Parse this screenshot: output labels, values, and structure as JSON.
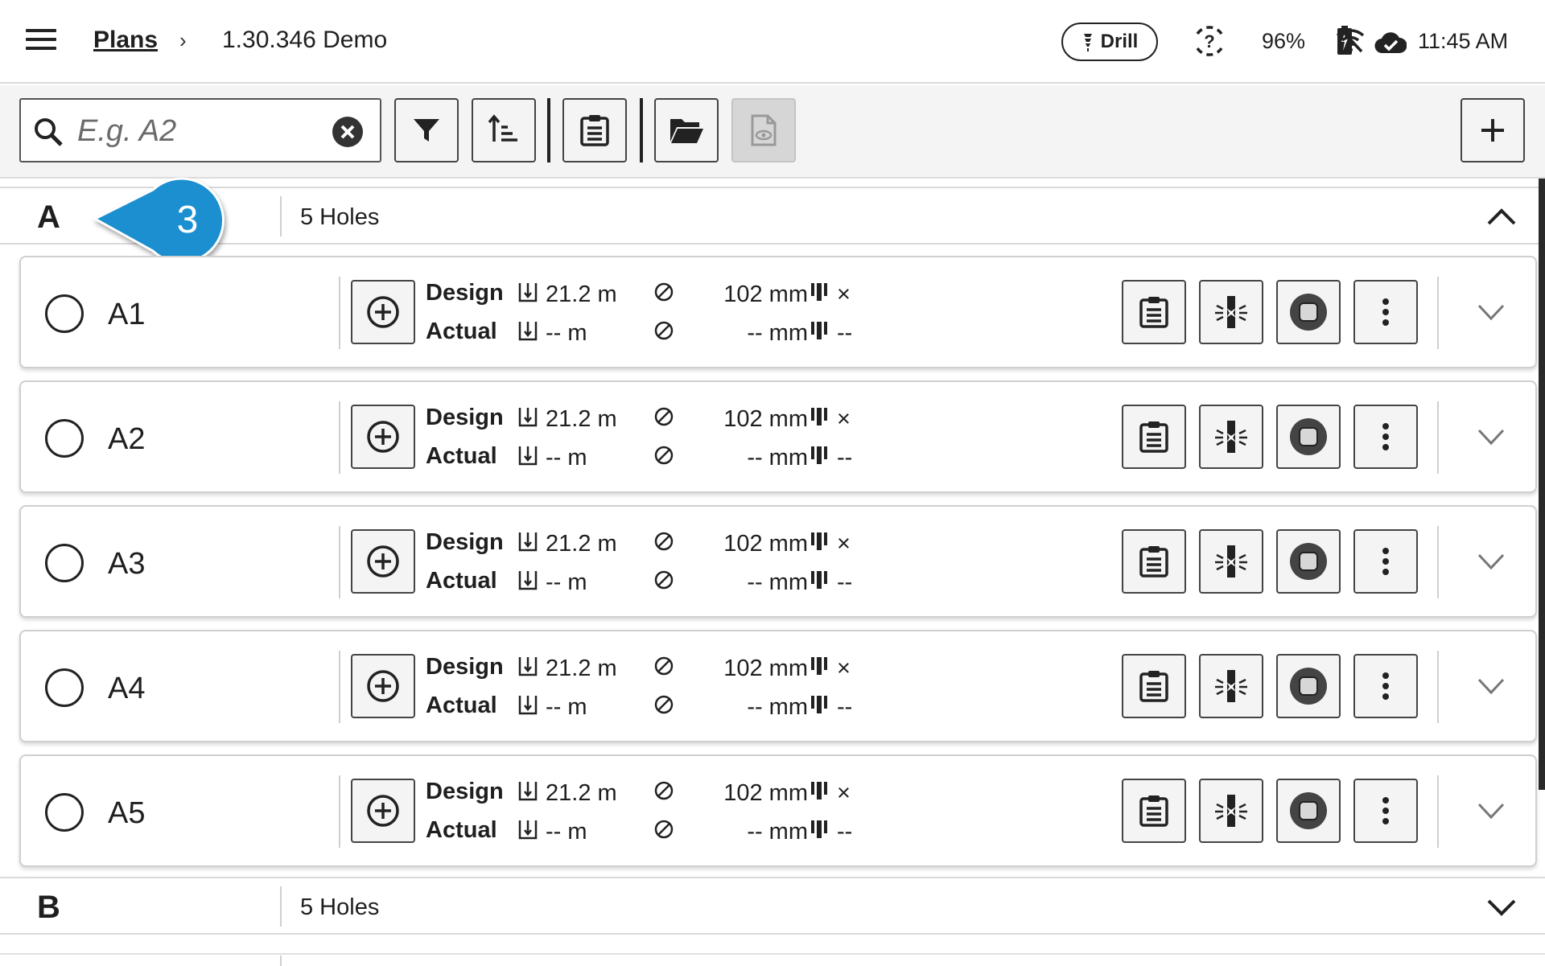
{
  "header": {
    "breadcrumb_root": "Plans",
    "breadcrumb_sep": "›",
    "breadcrumb_current": "1.30.346 Demo",
    "mode_label": "Drill",
    "battery": "96%",
    "time": "11:45 AM"
  },
  "toolbar": {
    "search_placeholder": "E.g. A2"
  },
  "callout": {
    "number": "3",
    "color": "#1b8fcf"
  },
  "groups": [
    {
      "letter": "A",
      "count": "5 Holes",
      "expanded": true
    },
    {
      "letter": "B",
      "count": "5 Holes",
      "expanded": false
    }
  ],
  "labels": {
    "design": "Design",
    "actual": "Actual"
  },
  "holes": [
    {
      "name": "A1",
      "design_depth": "21.2 m",
      "design_dia": "102 mm",
      "design_charge": "×",
      "actual_depth": "-- m",
      "actual_dia": "-- mm",
      "actual_charge": "--"
    },
    {
      "name": "A2",
      "design_depth": "21.2 m",
      "design_dia": "102 mm",
      "design_charge": "×",
      "actual_depth": "-- m",
      "actual_dia": "-- mm",
      "actual_charge": "--"
    },
    {
      "name": "A3",
      "design_depth": "21.2 m",
      "design_dia": "102 mm",
      "design_charge": "×",
      "actual_depth": "-- m",
      "actual_dia": "-- mm",
      "actual_charge": "--"
    },
    {
      "name": "A4",
      "design_depth": "21.2 m",
      "design_dia": "102 mm",
      "design_charge": "×",
      "actual_depth": "-- m",
      "actual_dia": "-- mm",
      "actual_charge": "--"
    },
    {
      "name": "A5",
      "design_depth": "21.2 m",
      "design_dia": "102 mm",
      "design_charge": "×",
      "actual_depth": "-- m",
      "actual_dia": "-- mm",
      "actual_charge": "--"
    }
  ],
  "icons": [
    "menu-icon",
    "drill-icon",
    "help-icon",
    "battery-charging-icon",
    "wifi-off-icon",
    "cloud-done-icon",
    "search-icon",
    "clear-icon",
    "filter-icon",
    "sort-icon",
    "clipboard-icon",
    "folder-open-icon",
    "document-preview-icon",
    "plus-icon",
    "add-circle-icon",
    "depth-icon",
    "diameter-icon",
    "charge-icon",
    "blast-icon",
    "stop-icon",
    "more-vert-icon",
    "chevron-down-icon",
    "chevron-up-icon"
  ]
}
